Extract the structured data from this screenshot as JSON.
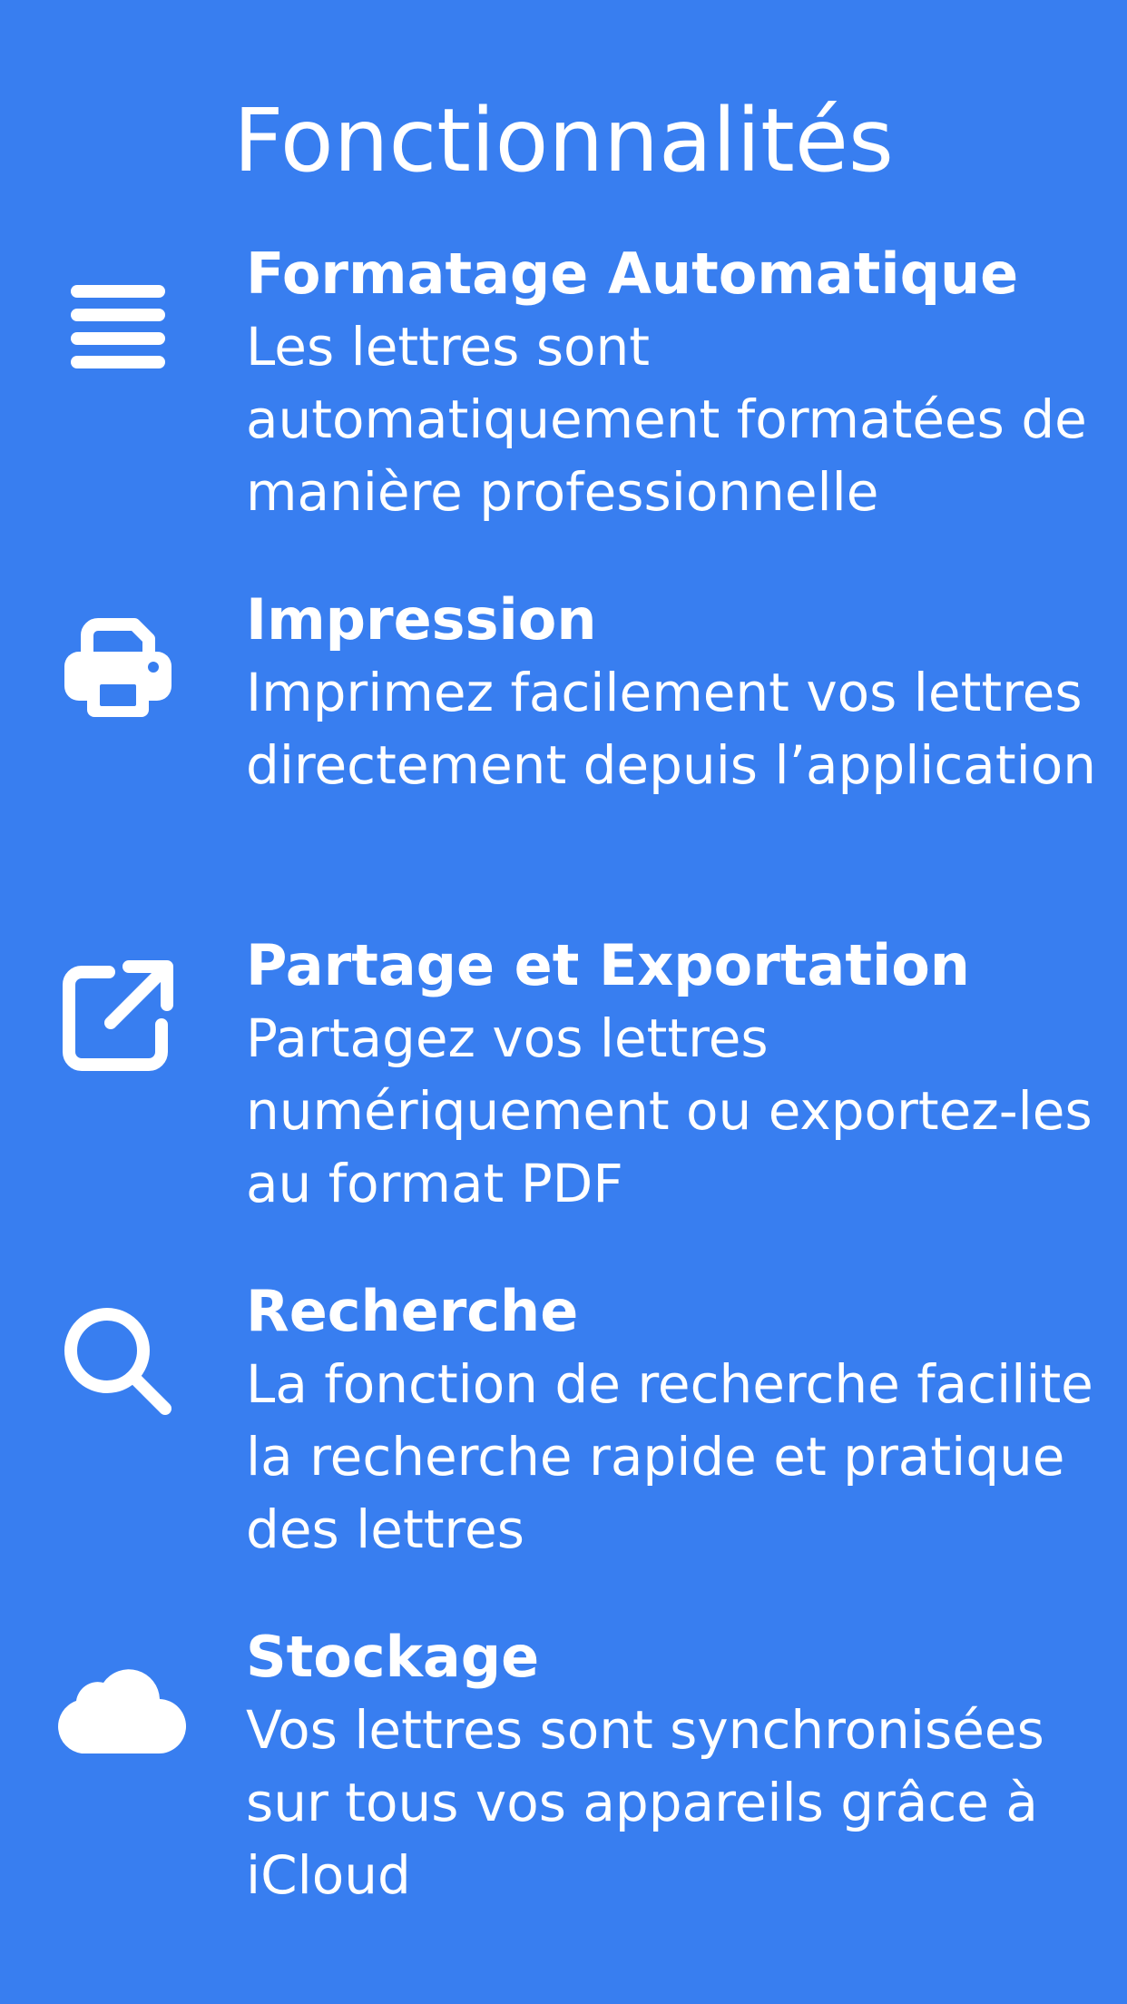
{
  "page": {
    "title": "Fonctionnalités",
    "background_color": "#387EF0",
    "text_color": "#FFFFFF"
  },
  "features": [
    {
      "icon": "lines-icon",
      "title": "Formatage Automatique",
      "description": "Les lettres sont automatiquement formatées de manière professionnelle"
    },
    {
      "icon": "printer-icon",
      "title": "Impression",
      "description": "Imprimez facilement vos lettres directement depuis l’application"
    },
    {
      "icon": "share-external-icon",
      "title": "Partage et Exportation",
      "description": "Partagez vos lettres numériquement ou exportez-les au format PDF"
    },
    {
      "icon": "search-icon",
      "title": "Recherche",
      "description": "La fonction de recherche facilite la recherche rapide et pratique des lettres"
    },
    {
      "icon": "cloud-icon",
      "title": "Stockage",
      "description": "Vos lettres sont synchronisées sur tous vos appareils grâce à iCloud"
    }
  ]
}
